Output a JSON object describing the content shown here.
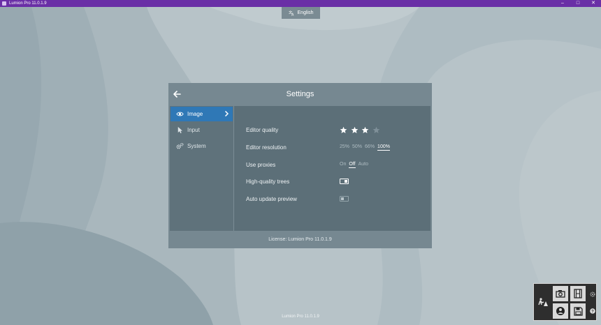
{
  "window": {
    "title": "Lumion Pro 11.0.1.9",
    "minimize": "–",
    "maximize": "□",
    "close": "✕",
    "title_bar_color": "#6a2fa6"
  },
  "language": {
    "label": "English",
    "icon": "translate-icon"
  },
  "settings": {
    "title": "Settings",
    "sidebar": [
      {
        "label": "Image",
        "icon": "eye-icon",
        "active": true
      },
      {
        "label": "Input",
        "icon": "cursor-icon",
        "active": false
      },
      {
        "label": "System",
        "icon": "gears-icon",
        "active": false
      }
    ],
    "options": {
      "editor_quality": {
        "label": "Editor quality",
        "stars_filled": 3,
        "stars_total": 4
      },
      "editor_resolution": {
        "label": "Editor resolution",
        "choices": [
          "25%",
          "50%",
          "66%",
          "100%"
        ],
        "selected": "100%"
      },
      "use_proxies": {
        "label": "Use proxies",
        "choices": [
          "On",
          "Off",
          "Auto"
        ],
        "selected": "Off"
      },
      "high_quality_trees": {
        "label": "High-quality trees",
        "value": "on"
      },
      "auto_update_preview": {
        "label": "Auto update preview",
        "value": "off"
      }
    },
    "license": "License: Lumion Pro 11.0.1.9"
  },
  "footer": {
    "version": "Lumion Pro 11.0.1.9"
  },
  "mode_panel": {
    "buttons": [
      "build-mode-icon",
      "photo-mode-icon",
      "movie-mode-icon",
      "360-panorama-icon",
      "save-icon"
    ],
    "side": [
      "settings-icon",
      "help-icon"
    ],
    "help_label": "?"
  },
  "colors": {
    "accent": "#2f78b6",
    "background": "#b3c0c5",
    "dialog": "#768891"
  }
}
